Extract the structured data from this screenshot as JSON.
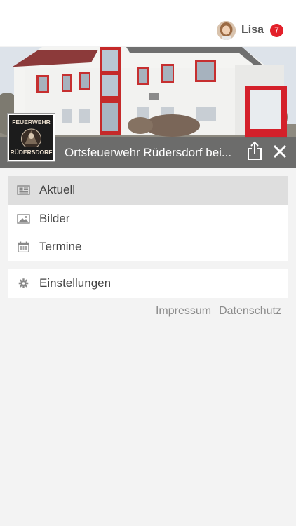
{
  "user": {
    "name": "Lisa",
    "notification_count": "7"
  },
  "organization": {
    "title": "Ortsfeuerwehr Rüdersdorf bei...",
    "logo_text_top": "FEUERWEHR",
    "logo_text_bottom": "RÜDERSDORF"
  },
  "nav": {
    "items": [
      {
        "label": "Aktuell",
        "icon": "newspaper-icon",
        "active": true
      },
      {
        "label": "Bilder",
        "icon": "image-icon",
        "active": false
      },
      {
        "label": "Termine",
        "icon": "calendar-icon",
        "active": false
      }
    ],
    "settings_label": "Einstellungen"
  },
  "footer": {
    "impressum": "Impressum",
    "datenschutz": "Datenschutz"
  },
  "colors": {
    "badge": "#e3202a",
    "hero_bar": "#696969",
    "active_item": "#dedede",
    "background": "#f3f3f3"
  }
}
